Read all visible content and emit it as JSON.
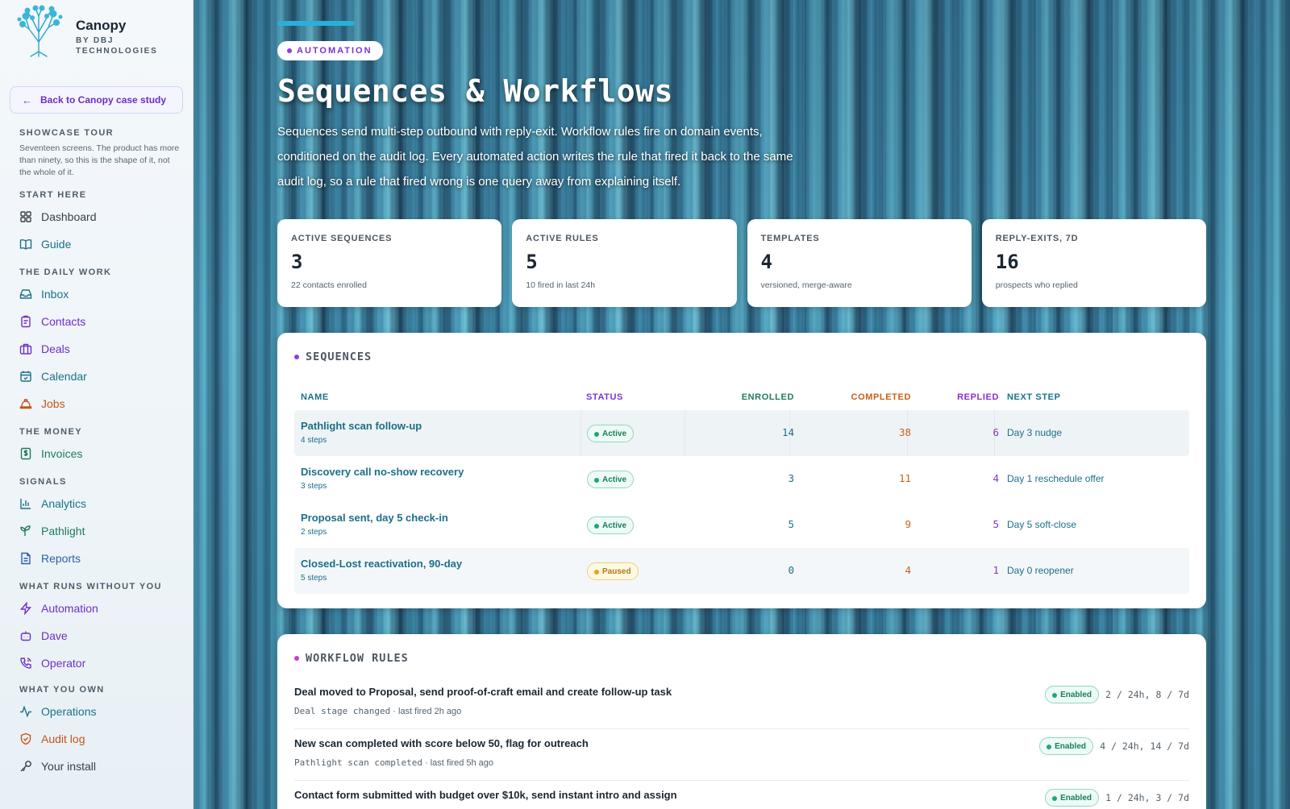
{
  "brand": {
    "name": "Canopy",
    "sub": "BY DBJ TECHNOLOGIES"
  },
  "back_button": {
    "label": "Back to Canopy case study"
  },
  "tour": {
    "title": "SHOWCASE TOUR",
    "desc": "Seventeen screens. The product has more than ninety, so this is the shape of it, not the whole of it."
  },
  "sections": {
    "start": "START HERE",
    "daily": "THE DAILY WORK",
    "money": "THE MONEY",
    "signals": "SIGNALS",
    "runs": "WHAT RUNS WITHOUT YOU",
    "own": "WHAT YOU OWN"
  },
  "nav": {
    "dashboard": "Dashboard",
    "guide": "Guide",
    "inbox": "Inbox",
    "contacts": "Contacts",
    "deals": "Deals",
    "calendar": "Calendar",
    "jobs": "Jobs",
    "invoices": "Invoices",
    "analytics": "Analytics",
    "pathlight": "Pathlight",
    "reports": "Reports",
    "automation": "Automation",
    "dave": "Dave",
    "operator": "Operator",
    "operations": "Operations",
    "audit": "Audit log",
    "install": "Your install"
  },
  "header": {
    "pill": "AUTOMATION",
    "title": "Sequences & Workflows",
    "desc": "Sequences send multi-step outbound with reply-exit. Workflow rules fire on domain events, conditioned on the audit log. Every automated action writes the rule that fired it back to the same audit log, so a rule that fired wrong is one query away from explaining itself."
  },
  "stats": [
    {
      "label": "ACTIVE SEQUENCES",
      "value": "3",
      "sub": "22 contacts enrolled"
    },
    {
      "label": "ACTIVE RULES",
      "value": "5",
      "sub": "10 fired in last 24h"
    },
    {
      "label": "TEMPLATES",
      "value": "4",
      "sub": "versioned, merge-aware"
    },
    {
      "label": "REPLY-EXITS, 7D",
      "value": "16",
      "sub": "prospects who replied"
    }
  ],
  "sequences": {
    "title": "SEQUENCES",
    "columns": {
      "name": "NAME",
      "status": "STATUS",
      "enrolled": "ENROLLED",
      "completed": "COMPLETED",
      "replied": "REPLIED",
      "next": "NEXT STEP"
    },
    "rows": [
      {
        "name": "Pathlight scan follow-up",
        "steps": "4 steps",
        "status": "Active",
        "enrolled": "14",
        "completed": "38",
        "replied": "6",
        "next": "Day 3 nudge"
      },
      {
        "name": "Discovery call no-show recovery",
        "steps": "3 steps",
        "status": "Active",
        "enrolled": "3",
        "completed": "11",
        "replied": "4",
        "next": "Day 1 reschedule offer"
      },
      {
        "name": "Proposal sent, day 5 check-in",
        "steps": "2 steps",
        "status": "Active",
        "enrolled": "5",
        "completed": "9",
        "replied": "5",
        "next": "Day 5 soft-close"
      },
      {
        "name": "Closed-Lost reactivation, 90-day",
        "steps": "5 steps",
        "status": "Paused",
        "enrolled": "0",
        "completed": "4",
        "replied": "1",
        "next": "Day 0 reopener"
      }
    ]
  },
  "workflow": {
    "title": "WORKFLOW RULES",
    "rules": [
      {
        "title": "Deal moved to Proposal, send proof-of-craft email and create follow-up task",
        "event": "Deal stage changed",
        "fired": "· last fired 2h ago",
        "status": "Enabled",
        "counts": "2 / 24h, 8 / 7d"
      },
      {
        "title": "New scan completed with score below 50, flag for outreach",
        "event": "Pathlight scan completed",
        "fired": "· last fired 5h ago",
        "status": "Enabled",
        "counts": "4 / 24h, 14 / 7d"
      },
      {
        "title": "Contact form submitted with budget over $10k, send instant intro and assign",
        "event": "",
        "fired": "",
        "status": "Enabled",
        "counts": "1 / 24h, 3 / 7d"
      }
    ]
  },
  "colors": {
    "accent": "#2ab0d8",
    "purple": "#8a3fe0",
    "teal": "#1a7286",
    "orange": "#c4621a"
  }
}
